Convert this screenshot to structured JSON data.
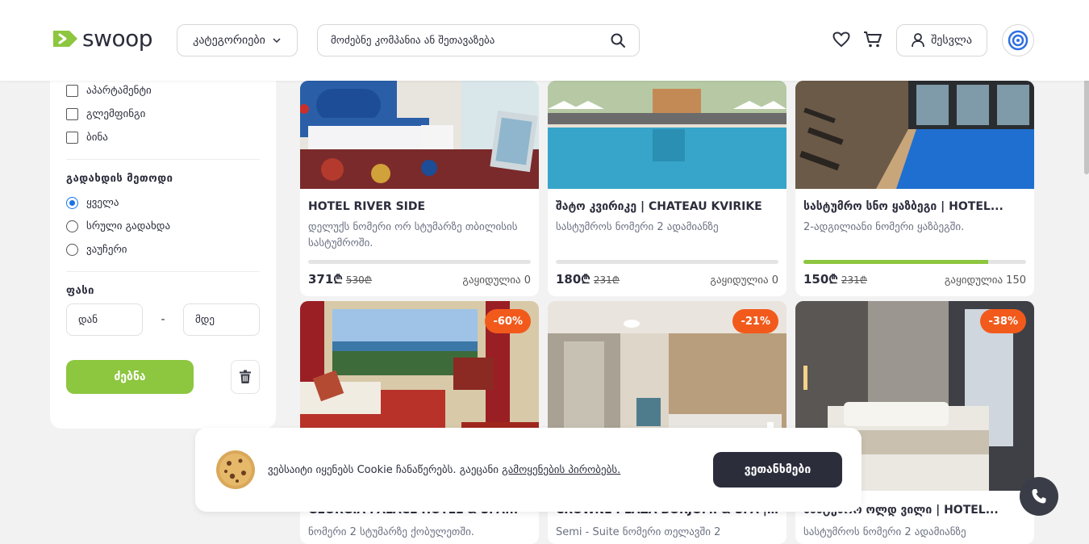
{
  "brand": {
    "name": "swoop",
    "green": "#8dc63f",
    "orange": "#f25a1c",
    "dark": "#2b2d3b"
  },
  "header": {
    "categories_label": "კატეგორიები",
    "search_placeholder": "მოძებნე კომპანია ან შეთავაზება",
    "login_label": "შესვლა"
  },
  "sidebar": {
    "checkboxes": [
      {
        "label": "აპარტამენტი",
        "checked": false
      },
      {
        "label": "გლემფინგი",
        "checked": false
      },
      {
        "label": "ბინა",
        "checked": false
      }
    ],
    "payment_title": "გადახდის მეთოდი",
    "payment_options": [
      {
        "label": "ყველა",
        "selected": true
      },
      {
        "label": "სრული გადახდა",
        "selected": false
      },
      {
        "label": "ვაუჩერი",
        "selected": false
      }
    ],
    "price_title": "ფასი",
    "price_from_placeholder": "დან",
    "price_dash": "-",
    "price_to_placeholder": "მდე",
    "search_button": "ძებნა"
  },
  "cards": [
    {
      "title": "HOTEL RIVER SIDE",
      "desc": "დელუქს ნომერი ორ სტუმარზე თბილისის სასტუმროში.",
      "price": "371₾",
      "old_price": "530₾",
      "sold": "გაყიდულია 0",
      "progress": 0
    },
    {
      "title": "შატო კვირიკე | CHATEAU KVIRIKE",
      "desc": "სასტუმროს ნომერი 2 ადამიანზე",
      "price": "180₾",
      "old_price": "231₾",
      "sold": "გაყიდულია 0",
      "progress": 0
    },
    {
      "title": "სასტუმრო სნო ყაზბეგი | HOTEL...",
      "desc": "2-ადგილიანი ნომერი ყაზბეგში.",
      "price": "150₾",
      "old_price": "231₾",
      "sold": "გაყიდულია 150",
      "progress": 0.83
    },
    {
      "title": "GEORGIA PALACE HOTEL & SPA...",
      "desc": "ნომერი 2 სტუმარზე ქობულეთში.",
      "badge": "-60%"
    },
    {
      "title": "CROWNE PLAZA BORJOMI & SPA |...",
      "desc": "Semi - Suite ნომერი თელავში 2",
      "badge": "-21%"
    },
    {
      "title": "სასტუმრო ოლდ ვილი | HOTEL...",
      "desc": "სასტუმროს ნომერი 2 ადამიანზე",
      "badge": "-38%"
    }
  ],
  "cookie": {
    "text": "ვებსაიტი იყენებს Cookie ჩანაწერებს. გაეცანი ",
    "link": "გამოყენების პირობებს.",
    "accept": "ვეთანხმები"
  }
}
